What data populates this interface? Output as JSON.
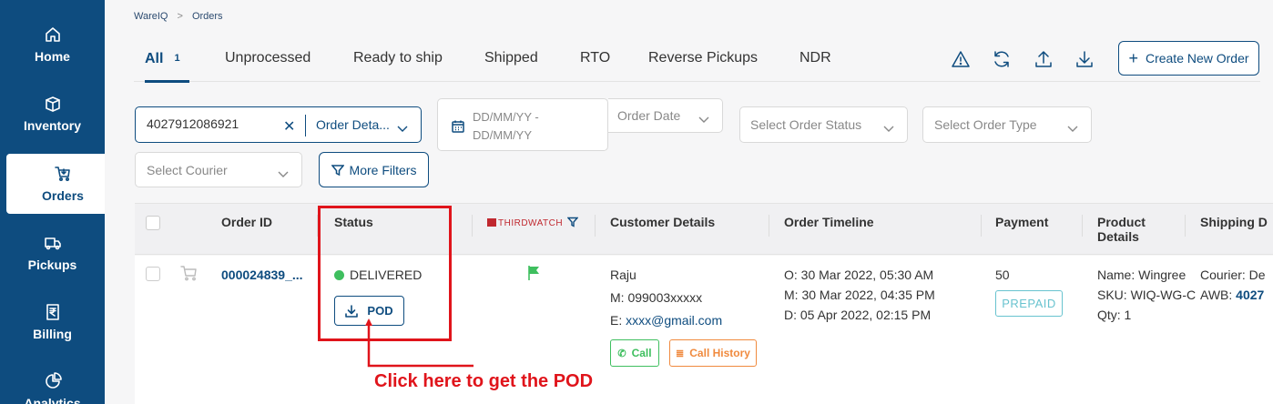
{
  "sidebar": {
    "items": [
      {
        "label": "Home",
        "icon": "home-icon"
      },
      {
        "label": "Inventory",
        "icon": "box-icon"
      },
      {
        "label": "Orders",
        "icon": "cart-icon",
        "active": true
      },
      {
        "label": "Pickups",
        "icon": "truck-icon"
      },
      {
        "label": "Billing",
        "icon": "rupee-receipt-icon"
      },
      {
        "label": "Analytics",
        "icon": "pie-chart-icon"
      }
    ]
  },
  "breadcrumb": {
    "root": "WareIQ",
    "separator": ">",
    "current": "Orders"
  },
  "tabs": [
    {
      "label": "All",
      "count": "1",
      "active": true
    },
    {
      "label": "Unprocessed"
    },
    {
      "label": "Ready to ship"
    },
    {
      "label": "Shipped"
    },
    {
      "label": "RTO"
    },
    {
      "label": "Reverse Pickups"
    },
    {
      "label": "NDR"
    }
  ],
  "toolbar": {
    "icons": [
      "warning-icon",
      "refresh-icon",
      "upload-icon",
      "download-icon"
    ],
    "create_label": "Create New Order"
  },
  "filters": {
    "search_value": "4027912086921",
    "search_type": "Order Deta...",
    "date_placeholder": "DD/MM/YY - DD/MM/YY",
    "date_type": "Order Date",
    "order_status_placeholder": "Select Order Status",
    "order_type_placeholder": "Select Order Type",
    "courier_placeholder": "Select Courier",
    "more_filters_label": "More Filters"
  },
  "table": {
    "columns": {
      "order_id": "Order ID",
      "status": "Status",
      "thirdwatch": "THIRDWATCH",
      "customer": "Customer Details",
      "timeline": "Order Timeline",
      "payment": "Payment",
      "product": "Product Details",
      "shipping": "Shipping D"
    },
    "rows": [
      {
        "order_id": "000024839_...",
        "status": "DELIVERED",
        "status_color": "#3fbf5f",
        "pod_label": "POD",
        "customer_name": "Raju",
        "customer_mobile": "M: 099003xxxxx",
        "customer_email_prefix": "E: ",
        "customer_email": "xxxx@gmail.com",
        "call_label": "Call",
        "call_history_label": "Call History",
        "timeline_o": "O: 30 Mar 2022, 05:30 AM",
        "timeline_m": "M: 30 Mar 2022, 04:35 PM",
        "timeline_d": "D: 05 Apr 2022, 02:15 PM",
        "payment_amount": "50",
        "payment_mode": "PREPAID",
        "product_name": "Name: Wingree",
        "product_sku": "SKU: WIQ-WG-C",
        "product_qty": "Qty: 1",
        "shipping_courier": "Courier: De",
        "shipping_awb_prefix": "AWB: ",
        "shipping_awb": "4027"
      }
    ]
  },
  "annotation": {
    "text": "Click here to get the POD",
    "color": "#e0141b"
  },
  "colors": {
    "brand": "#0e4c7f",
    "success": "#3fbf5f",
    "warning": "#f08a3e",
    "prepaid": "#68c3cf"
  }
}
